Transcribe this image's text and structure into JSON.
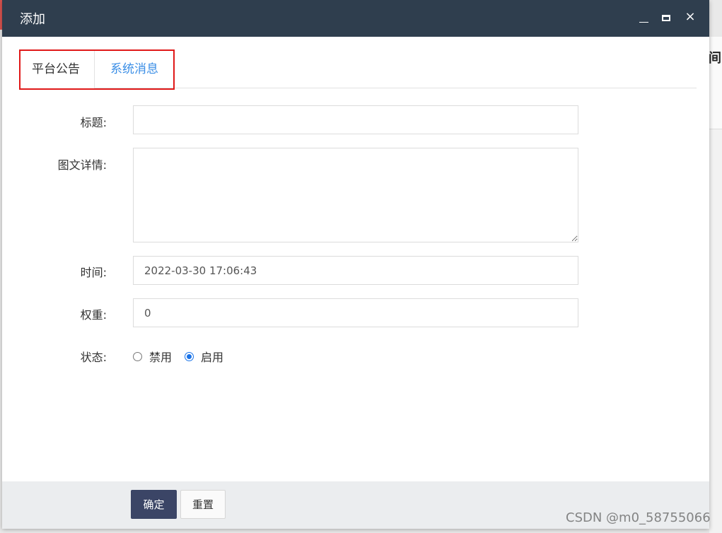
{
  "modal": {
    "title": "添加",
    "minimize_icon": "minimize-icon",
    "maximize_icon": "maximize-icon",
    "close_symbol": "×"
  },
  "tabs": [
    {
      "label": "平台公告",
      "active": false
    },
    {
      "label": "系统消息",
      "active": true
    }
  ],
  "form": {
    "title_label": "标题:",
    "title_value": "",
    "detail_label": "图文详情:",
    "detail_value": "",
    "time_label": "时间:",
    "time_value": "2022-03-30 17:06:43",
    "weight_label": "权重:",
    "weight_value": "0",
    "status_label": "状态:",
    "status_options": [
      {
        "label": "禁用",
        "checked": false
      },
      {
        "label": "启用",
        "checked": true
      }
    ]
  },
  "footer": {
    "confirm_label": "确定",
    "reset_label": "重置"
  },
  "watermark": "CSDN @m0_58755066",
  "background": {
    "partial_glyph": "间"
  },
  "colors": {
    "header_bg": "#2f3e4e",
    "active_tab": "#3a8ee6",
    "confirm_bg": "#3b4566",
    "highlight_border": "#e01818",
    "radio_checked": "#1a73e8"
  }
}
